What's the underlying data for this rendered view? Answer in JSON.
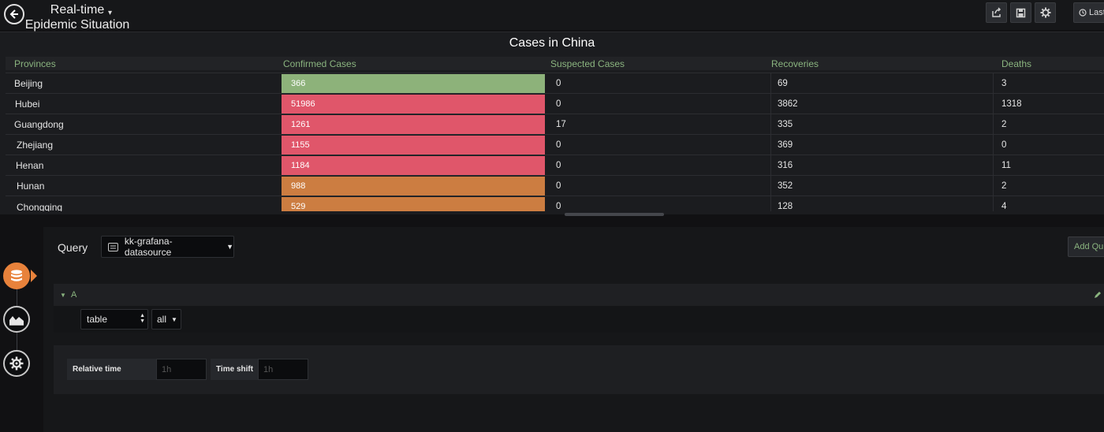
{
  "header": {
    "title_line1": "Real-time",
    "title_line2": "Epidemic Situation",
    "back_icon": "arrow-left-icon",
    "time_picker_label": "Last"
  },
  "panel": {
    "title": "Cases in China",
    "columns": [
      "Provinces",
      "Confirmed Cases",
      "Suspected Cases",
      "Recoveries",
      "Deaths"
    ],
    "rows": [
      {
        "province": "Beijing",
        "confirmed": "366",
        "suspected": "0",
        "recoveries": "69",
        "deaths": "3",
        "color": "#8db27a"
      },
      {
        "province": "Hubei",
        "confirmed": "51986",
        "suspected": "0",
        "recoveries": "3862",
        "deaths": "1318",
        "color": "#e0566a"
      },
      {
        "province": "Guangdong",
        "confirmed": "1261",
        "suspected": "17",
        "recoveries": "335",
        "deaths": "2",
        "color": "#e0566a"
      },
      {
        "province": "Zhejiang",
        "confirmed": "1155",
        "suspected": "0",
        "recoveries": "369",
        "deaths": "0",
        "color": "#e0566a"
      },
      {
        "province": "Henan",
        "confirmed": "1184",
        "suspected": "0",
        "recoveries": "316",
        "deaths": "11",
        "color": "#e0566a"
      },
      {
        "province": "Hunan",
        "confirmed": "988",
        "suspected": "0",
        "recoveries": "352",
        "deaths": "2",
        "color": "#cc7d41"
      },
      {
        "province": "Chongqing",
        "confirmed": "529",
        "suspected": "0",
        "recoveries": "128",
        "deaths": "4",
        "color": "#cc7d41"
      }
    ]
  },
  "editor": {
    "query_label": "Query",
    "datasource": "kk-grafana-datasource",
    "add_query_label": "Add Qu",
    "query_ref": "A",
    "format_select": "table",
    "target_select": "all",
    "relative_time_label": "Relative time",
    "relative_time_placeholder": "1h",
    "time_shift_label": "Time shift",
    "time_shift_placeholder": "1h"
  },
  "side_tabs": [
    "database-icon",
    "visualization-icon",
    "settings-gear-icon"
  ],
  "colors": {
    "accent": "#e8823b",
    "header_green": "#8ab47f"
  }
}
